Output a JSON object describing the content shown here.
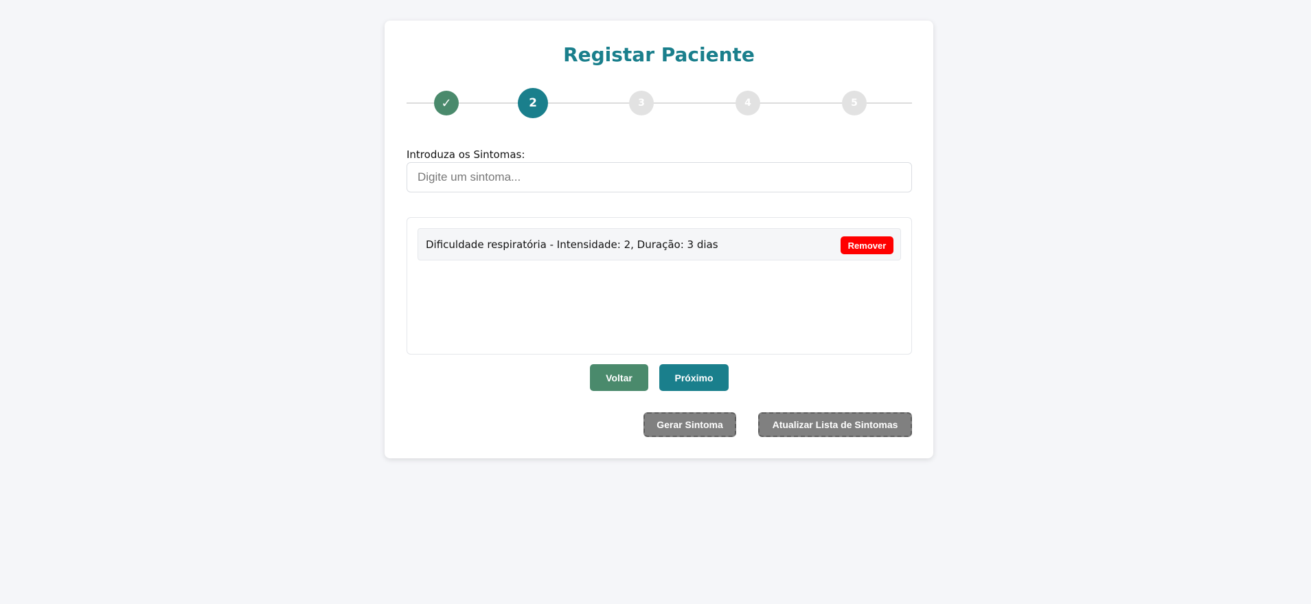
{
  "page": {
    "title": "Registar Paciente"
  },
  "stepper": {
    "steps": [
      {
        "label": "✓",
        "state": "done"
      },
      {
        "label": "2",
        "state": "active"
      },
      {
        "label": "3",
        "state": "pending"
      },
      {
        "label": "4",
        "state": "pending"
      },
      {
        "label": "5",
        "state": "pending"
      }
    ]
  },
  "symptoms": {
    "label": "Introduza os Sintomas:",
    "placeholder": "Digite um sintoma...",
    "value": "",
    "items": [
      {
        "text": "Dificuldade respiratória - Intensidade: 2, Duração: 3 dias",
        "remove_label": "Remover"
      }
    ]
  },
  "nav": {
    "back_label": "Voltar",
    "next_label": "Próximo"
  },
  "actions": {
    "generate_label": "Gerar Sintoma",
    "refresh_label": "Atualizar Lista de Sintomas"
  },
  "colors": {
    "background": "#f5f6f9",
    "primary": "#1a7f8c",
    "success": "#4a8a6c",
    "danger": "#ff0000",
    "pending": "#e2e2e2",
    "utility": "#808080"
  }
}
